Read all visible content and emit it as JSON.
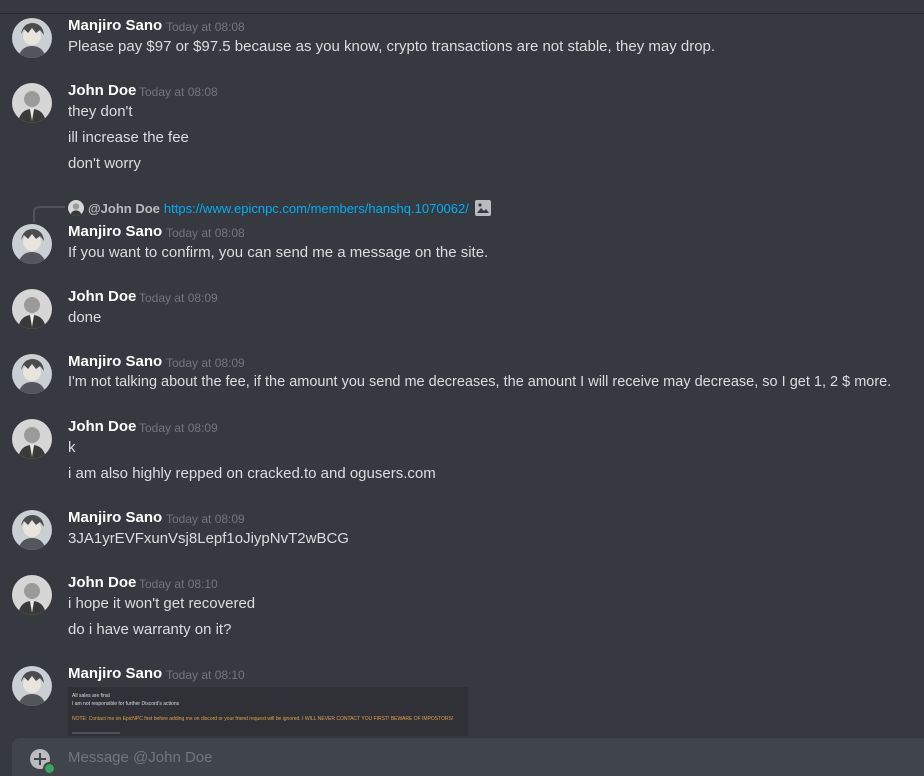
{
  "composer": {
    "placeholder": "Message @John Doe"
  },
  "reply": {
    "name": "@John Doe",
    "link": "https://www.epicnpc.com/members/hanshq.1070062/"
  },
  "messages": [
    {
      "author": "Manjiro Sano",
      "time": "Today at 08:08",
      "lines": [
        "Please pay $97 or $97.5 because as you know, crypto transactions are not stable, they may drop."
      ]
    },
    {
      "author": "John Doe",
      "time": "Today at 08:08",
      "lines": [
        "they don't",
        "ill increase the fee",
        "don't worry"
      ]
    },
    {
      "author": "Manjiro Sano",
      "time": "Today at 08:08",
      "lines": [
        "If you want to confirm, you can send me a message on the site."
      ]
    },
    {
      "author": "John Doe",
      "time": "Today at 08:09",
      "lines": [
        "done"
      ]
    },
    {
      "author": "Manjiro Sano",
      "time": "Today at 08:09",
      "lines": [
        "I'm not talking about the fee, if the amount you send me decreases, the amount I will receive may decrease, so I get 1, 2 $ more."
      ]
    },
    {
      "author": "John Doe",
      "time": "Today at 08:09",
      "lines": [
        "k",
        "i am also highly repped on cracked.to and ogusers.com"
      ]
    },
    {
      "author": "Manjiro Sano",
      "time": "Today at 08:09",
      "lines": [
        "3JA1yrEVFxunVsj8Lepf1oJiypNvT2wBCG"
      ]
    },
    {
      "author": "John Doe",
      "time": "Today at 08:10",
      "lines": [
        "i hope it won't get recovered",
        "do i have warranty on it?"
      ]
    },
    {
      "author": "Manjiro Sano",
      "time": "Today at 08:10",
      "lines": []
    }
  ],
  "attachment": {
    "line1": "All sales are final",
    "line2": "I am not responsible for further Discord's actions",
    "line3": "NOTE: Contact me on EpicNPC first before adding me on discord or your friend request will be ignored. I WILL NEVER CONTACT YOU FIRST! BEWARE OF IMPOSTORS!"
  }
}
